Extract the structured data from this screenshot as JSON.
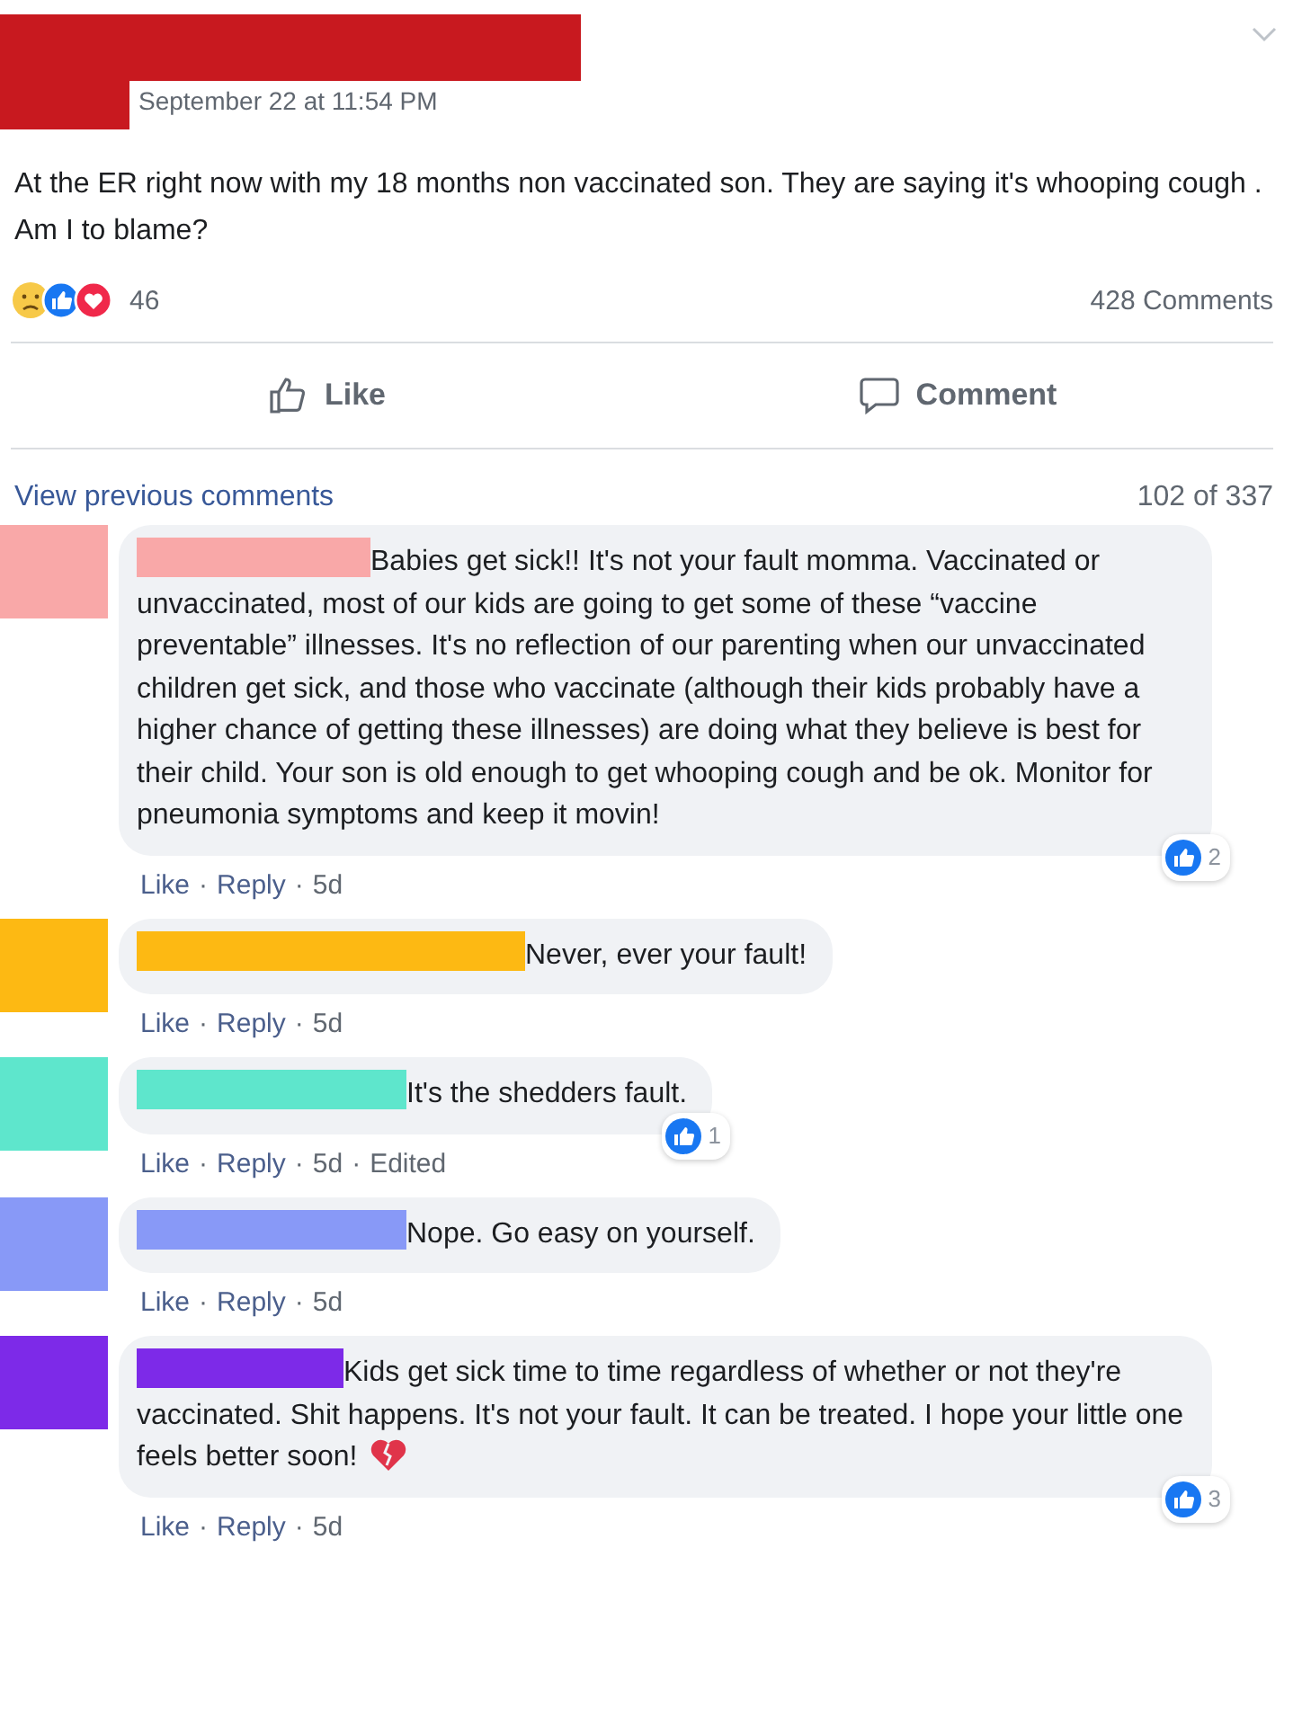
{
  "post": {
    "color": "#c8191f",
    "timestamp": "September 22 at 11:54 PM",
    "text": "At the ER right now with my 18 months non vaccinated son. They are saying it's whooping cough . Am I to blame?",
    "reaction_count": "46",
    "comment_count": "428 Comments",
    "actions": [
      "Like",
      "Comment"
    ]
  },
  "comments_header": {
    "link": "View previous comments",
    "count": "102 of 337"
  },
  "comments": [
    {
      "color": "#f9a8a8",
      "text": "Babies get sick!! It's not your fault momma. Vaccinated or unvaccinated, most of our kids are going to get some of these “vaccine preventable” illnesses. It's no reflection of our parenting when our unvaccinated children get sick, and those who vaccinate (although their kids probably have a higher chance of getting these illnesses) are doing what they believe is best for their child. Your son is old enough to get whooping cough and be ok. Monitor for pneumonia symptoms and keep it movin!",
      "likes": "2",
      "meta": [
        {
          "kind": "link",
          "text": "Like"
        },
        {
          "kind": "sep",
          "text": "·"
        },
        {
          "kind": "link",
          "text": "Reply"
        },
        {
          "kind": "sep",
          "text": "·"
        },
        {
          "kind": "time",
          "text": "5d"
        }
      ]
    },
    {
      "color": "#fdb913",
      "text": "Never, ever your fault!",
      "meta": [
        {
          "kind": "link",
          "text": "Like"
        },
        {
          "kind": "sep",
          "text": "·"
        },
        {
          "kind": "link",
          "text": "Reply"
        },
        {
          "kind": "sep",
          "text": "·"
        },
        {
          "kind": "time",
          "text": "5d"
        }
      ]
    },
    {
      "color": "#5ee6cc",
      "text": "It's the shedders fault.",
      "likes": "1",
      "meta": [
        {
          "kind": "link",
          "text": "Like"
        },
        {
          "kind": "sep",
          "text": "·"
        },
        {
          "kind": "link",
          "text": "Reply"
        },
        {
          "kind": "sep",
          "text": "·"
        },
        {
          "kind": "time",
          "text": "5d"
        },
        {
          "kind": "sep",
          "text": "·"
        },
        {
          "kind": "time",
          "text": "Edited"
        }
      ]
    },
    {
      "color": "#8899f7",
      "text": "Nope. Go easy on yourself.",
      "meta": [
        {
          "kind": "link",
          "text": "Like"
        },
        {
          "kind": "sep",
          "text": "·"
        },
        {
          "kind": "link",
          "text": "Reply"
        },
        {
          "kind": "sep",
          "text": "·"
        },
        {
          "kind": "time",
          "text": "5d"
        }
      ]
    },
    {
      "color": "#7d2ae8",
      "text": "Kids get sick time to time regardless of whether or not they're vaccinated. Shit happens. It's not your fault. It can be treated. I hope your little one feels better soon!",
      "heart": true,
      "likes": "3",
      "meta": [
        {
          "kind": "link",
          "text": "Like"
        },
        {
          "kind": "sep",
          "text": "·"
        },
        {
          "kind": "link",
          "text": "Reply"
        },
        {
          "kind": "sep",
          "text": "·"
        },
        {
          "kind": "time",
          "text": "5d"
        }
      ]
    }
  ]
}
